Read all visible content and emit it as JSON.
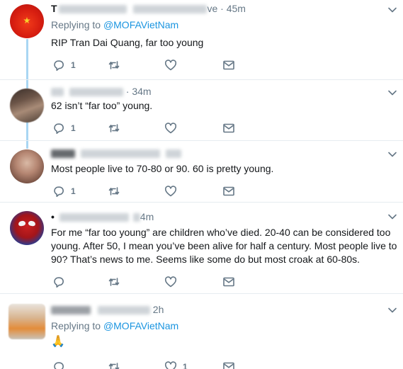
{
  "tweets": [
    {
      "author_initial": "T",
      "handle_suffix": "ve",
      "time": "· 45m",
      "reply_label": "Replying to",
      "reply_mention": "@MOFAVietNam",
      "text": "RIP Tran Dai Quang, far too young",
      "reply_count": "1"
    },
    {
      "time": "· 34m",
      "text": "62 isn’t “far too” young.",
      "reply_count": "1"
    },
    {
      "text": "Most people live to 70-80 or 90. 60 is pretty young.",
      "reply_count": "1"
    },
    {
      "bullet": "•",
      "time_fragment": "4m",
      "text": "For me “far too young” are children who’ve died. 20-40 can be considered too young. After 50, I mean you’ve been alive for half a century. Most people live to 90? That’s news to me. Seems like some do but most croak at 60-80s.",
      "reply_count": ""
    },
    {
      "time": "2h",
      "reply_label": "Replying to",
      "reply_mention": "@MOFAVietNam",
      "text": "🙏",
      "like_count": "1"
    }
  ],
  "icons": {
    "reply": "reply-icon",
    "retweet": "retweet-icon",
    "like": "heart-icon",
    "dm": "envelope-icon",
    "more": "chevron-down-icon"
  },
  "colors": {
    "link": "#1b95e0",
    "muted": "#657786",
    "thread_line": "#a9d6f3"
  }
}
